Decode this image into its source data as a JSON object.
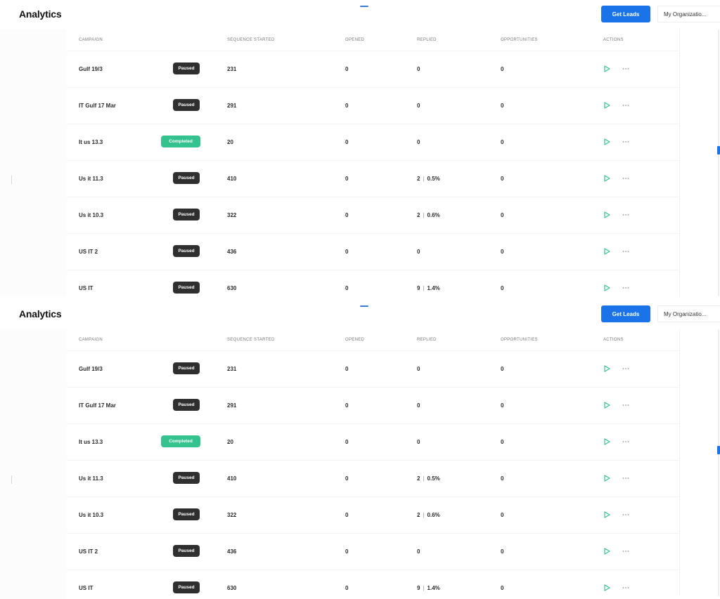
{
  "header": {
    "title": "Analytics",
    "get_leads_label": "Get Leads",
    "org_label": "My Organizatio..."
  },
  "columns": [
    "CAMPAIGN",
    "SEQUENCE STARTED",
    "OPENED",
    "REPLIED",
    "OPPORTUNITIES",
    "ACTIONS"
  ],
  "rows": [
    {
      "campaign": "Gulf 19/3",
      "status": "Paused",
      "status_type": "paused",
      "sequence_started": "231",
      "opened": "0",
      "replied": "0",
      "replied_pct": "",
      "opportunities": "0"
    },
    {
      "campaign": "IT Gulf 17 Mar",
      "status": "Paused",
      "status_type": "paused",
      "sequence_started": "291",
      "opened": "0",
      "replied": "0",
      "replied_pct": "",
      "opportunities": "0"
    },
    {
      "campaign": "It us 13.3",
      "status": "Completed",
      "status_type": "completed",
      "sequence_started": "20",
      "opened": "0",
      "replied": "0",
      "replied_pct": "",
      "opportunities": "0"
    },
    {
      "campaign": "Us it 11.3",
      "status": "Paused",
      "status_type": "paused",
      "sequence_started": "410",
      "opened": "0",
      "replied": "2",
      "replied_pct": "0.5%",
      "opportunities": "0"
    },
    {
      "campaign": "Us it 10.3",
      "status": "Paused",
      "status_type": "paused",
      "sequence_started": "322",
      "opened": "0",
      "replied": "2",
      "replied_pct": "0.6%",
      "opportunities": "0"
    },
    {
      "campaign": "US IT 2",
      "status": "Paused",
      "status_type": "paused",
      "sequence_started": "436",
      "opened": "0",
      "replied": "0",
      "replied_pct": "",
      "opportunities": "0"
    },
    {
      "campaign": "US IT",
      "status": "Paused",
      "status_type": "paused",
      "sequence_started": "630",
      "opened": "0",
      "replied": "9",
      "replied_pct": "1.4%",
      "opportunities": "0"
    }
  ],
  "icons": {
    "play": "play-icon",
    "more": "more-horizontal-icon"
  },
  "colors": {
    "accent": "#1a73e8",
    "paused_badge": "#2f2f2f",
    "completed_badge": "#34c38f",
    "play_icon": "#34c38f"
  }
}
